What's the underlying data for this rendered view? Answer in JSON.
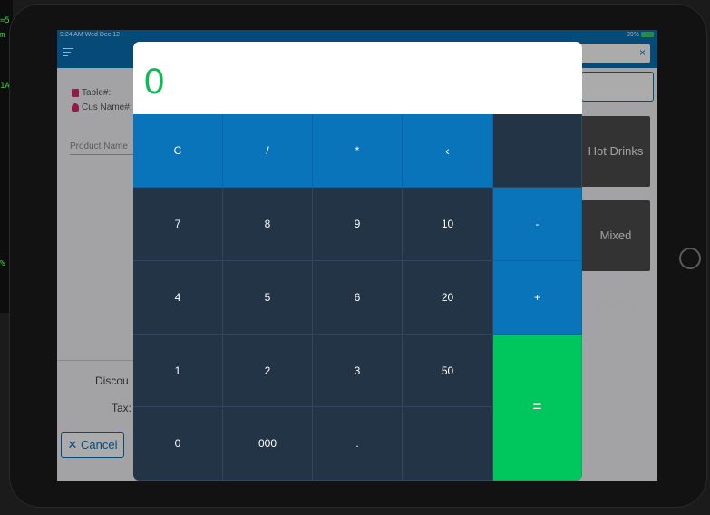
{
  "terminal": {
    "lines": [
      "=5",
      "m",
      "1A",
      "%"
    ]
  },
  "status_bar": {
    "time": "9:24 AM  Wed Dec 12",
    "battery": "99%"
  },
  "app_bar": {
    "close_label": "×"
  },
  "order_form": {
    "table_label": "Table#:",
    "customer_label": "Cus Name#:",
    "product_placeholder": "Product Name",
    "discount_label": "Discou",
    "tax_label": "Tax:",
    "cancel_label": "Cancel",
    "cancel_icon": "✕"
  },
  "categories": [
    "Hot Drinks",
    "Mixed Shisha"
  ],
  "calculator": {
    "display": "0",
    "keys": {
      "clear": "C",
      "divide": "/",
      "multiply": "*",
      "backspace": "‹",
      "seven": "7",
      "eight": "8",
      "nine": "9",
      "ten": "10",
      "minus": "-",
      "four": "4",
      "five": "5",
      "six": "6",
      "twenty": "20",
      "plus": "+",
      "one": "1",
      "two": "2",
      "three": "3",
      "fifty": "50",
      "equals": "=",
      "zero": "0",
      "triple_zero": "000",
      "decimal": "."
    }
  },
  "colors": {
    "accent_blue": "#0a74bb",
    "display_green": "#12b857",
    "equals_green": "#00c65e",
    "key_dark": "#243447"
  }
}
